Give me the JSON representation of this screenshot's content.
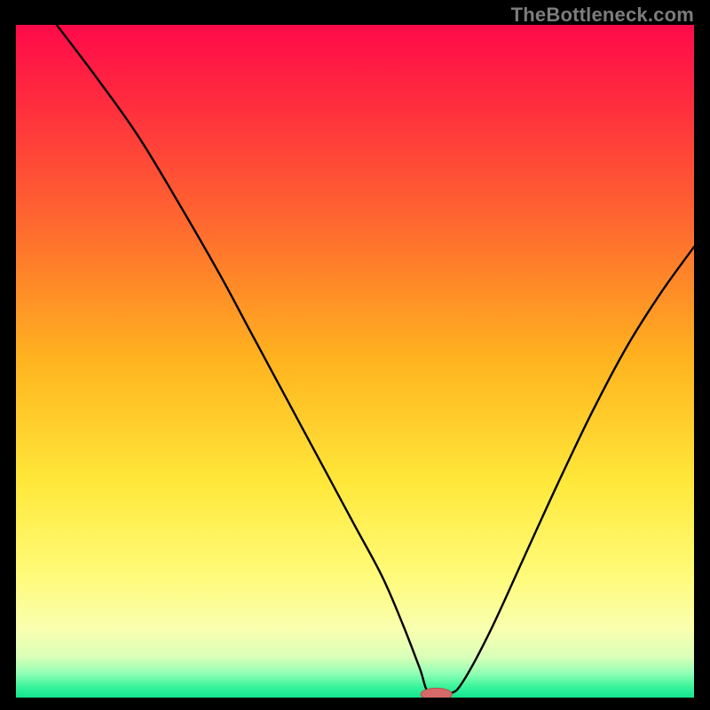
{
  "watermark": "TheBottleneck.com",
  "colors": {
    "frame": "#000000",
    "curve": "#000000",
    "marker_fill": "#d46a6a",
    "marker_stroke": "#b94f4f",
    "gradient_stops": [
      {
        "offset": 0.0,
        "color": "#ff0a4a"
      },
      {
        "offset": 0.12,
        "color": "#ff2e3e"
      },
      {
        "offset": 0.3,
        "color": "#ff6a2f"
      },
      {
        "offset": 0.5,
        "color": "#ffb41f"
      },
      {
        "offset": 0.68,
        "color": "#ffe83a"
      },
      {
        "offset": 0.82,
        "color": "#fffb7a"
      },
      {
        "offset": 0.9,
        "color": "#f9ffb0"
      },
      {
        "offset": 0.94,
        "color": "#d9ffb8"
      },
      {
        "offset": 0.965,
        "color": "#8dffb4"
      },
      {
        "offset": 0.985,
        "color": "#35f39a"
      },
      {
        "offset": 1.0,
        "color": "#14e48f"
      }
    ]
  },
  "chart_data": {
    "type": "line",
    "title": "",
    "xlabel": "",
    "ylabel": "",
    "xlim": [
      0,
      100
    ],
    "ylim": [
      0,
      100
    ],
    "grid": false,
    "legend": false,
    "marker": {
      "x": 62,
      "y": 0.5,
      "rx": 2.3,
      "ry": 0.9
    },
    "series": [
      {
        "name": "bottleneck-curve",
        "x": [
          6,
          12,
          18,
          24,
          30,
          34,
          38,
          42,
          46,
          50,
          54,
          57,
          59.5,
          61,
          64,
          66,
          70,
          75,
          80,
          85,
          90,
          95,
          100
        ],
        "y": [
          100,
          92,
          83.5,
          73.5,
          63,
          55.5,
          48,
          40.5,
          33,
          25.5,
          18,
          11,
          4.5,
          0.6,
          0.6,
          2.5,
          10,
          21,
          32,
          42.5,
          52,
          60,
          67
        ]
      }
    ]
  }
}
